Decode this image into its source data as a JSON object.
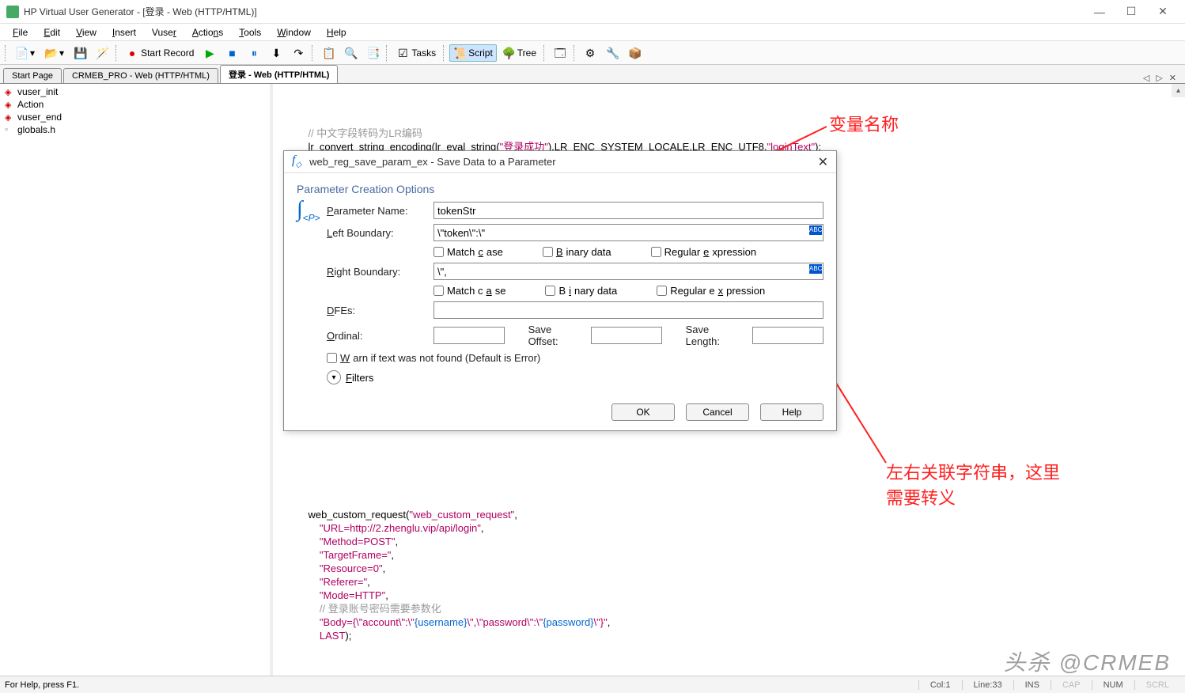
{
  "window": {
    "title": "HP Virtual User Generator - [登录 - Web (HTTP/HTML)]"
  },
  "menu": [
    "File",
    "Edit",
    "View",
    "Insert",
    "Vuser",
    "Actions",
    "Tools",
    "Window",
    "Help"
  ],
  "toolbar": {
    "start_record": "Start Record",
    "tasks": "Tasks",
    "script": "Script",
    "tree": "Tree"
  },
  "tabs": [
    "Start Page",
    "CRMEB_PRO - Web (HTTP/HTML)",
    "登录 - Web (HTTP/HTML)"
  ],
  "active_tab": 2,
  "sidebar": [
    "vuser_init",
    "Action",
    "vuser_end",
    "globals.h"
  ],
  "code": {
    "c1": "// 中文字段转码为LR编码",
    "l1a": "lr_convert_string_encoding",
    "l1b": "lr_eval_string",
    "l1s1": "\"登录成功\"",
    "l1s2": "\"loginText\"",
    "l1c": ",LR_ENC_SYSTEM_LOCALE,LR_ENC_UTF8,",
    "r1": "web_custom_request",
    "r1a": "\"web_custom_request\"",
    "r2": "\"URL=http://2.zhenglu.vip/api/login\"",
    "r3": "\"Method=POST\"",
    "r4": "\"TargetFrame=\"",
    "r5": "\"Resource=0\"",
    "r6": "\"Referer=\"",
    "r7": "\"Mode=HTTP\"",
    "c2": "// 登录账号密码需要参数化",
    "r8a": "\"Body={\\\"account\\\":\\\"",
    "r8b": "{username}",
    "r8c": "\\\",\\\"password\\\":\\\"",
    "r8d": "{password}",
    "r8e": "\\\"}\"",
    "last": "LAST"
  },
  "dialog": {
    "title": "web_reg_save_param_ex - Save Data to a Parameter",
    "section": "Parameter Creation Options",
    "param_label": "Parameter Name:",
    "param_value": "tokenStr",
    "lb_label": "Left Boundary:",
    "lb_value": "\\\"token\\\":\\\"",
    "rb_label": "Right Boundary:",
    "rb_value": "\\\",",
    "match_case": "Match case",
    "binary": "Binary data",
    "regex": "Regular expression",
    "dfes": "DFEs:",
    "ordinal": "Ordinal:",
    "save_offset": "Save Offset:",
    "save_length": "Save Length:",
    "warn": "Warn if text was not found (Default is Error)",
    "filters": "Filters",
    "ok": "OK",
    "cancel": "Cancel",
    "help": "Help"
  },
  "annotations": {
    "a1": "变量名称",
    "a2": "左右关联字符串，这里",
    "a3": "需要转义"
  },
  "status": {
    "help": "For Help, press F1.",
    "col": "Col:1",
    "line": "Line:33",
    "ins": "INS",
    "cap": "CAP",
    "num": "NUM",
    "scrl": "SCRL"
  },
  "watermark": "头杀 @CRMEB"
}
